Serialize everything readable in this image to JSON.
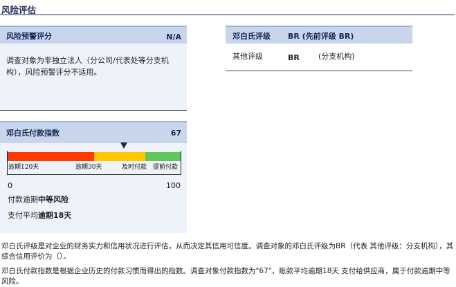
{
  "page": {
    "title": "风险评估"
  },
  "early_warning": {
    "title": "风险预警评分",
    "score": "N/A",
    "description": "调查对象为非独立法人（分公司/代表处等分支机构），风险预警评分不适用。"
  },
  "dnb_rating": {
    "title": "邓白氏评级",
    "rating_header": "BR (先前评级 BR)",
    "row_label": "其他评级",
    "row_value": "BR",
    "row_note": "(分支机构)"
  },
  "paydex": {
    "title": "邓白氏付款指数",
    "score": "67",
    "gauge_value": 67,
    "segments": [
      {
        "label": "逾期120天",
        "color": "#ff3b00"
      },
      {
        "label": "逾期30天",
        "color": "#ffc800"
      },
      {
        "label": "及时付款",
        "color": "#ffc800"
      },
      {
        "label": "提前付款",
        "color": "#5ec85c"
      }
    ],
    "scale_min": "0",
    "scale_max": "100",
    "marker_icon": "down-triangle-icon",
    "line1_prefix": "付款逾期",
    "line1_bold": "中等风险",
    "line2_prefix": "支付平均",
    "line2_bold": "逾期18天"
  },
  "footer": {
    "para1": "邓白氏评级是对企业的财务实力和信用状况进行评估，从而决定其信用可信度。调查对象的邓白氏评级为BR（代表 其他评级：分支机构），其综合信用评价为（）。",
    "para2": "邓白氏付款指数是根据企业历史的付款习惯而得出的指数。调查对象付款指数为\"67\"，账款平均逾期18天 支付给供应商，属于付款逾期中等风险。"
  }
}
